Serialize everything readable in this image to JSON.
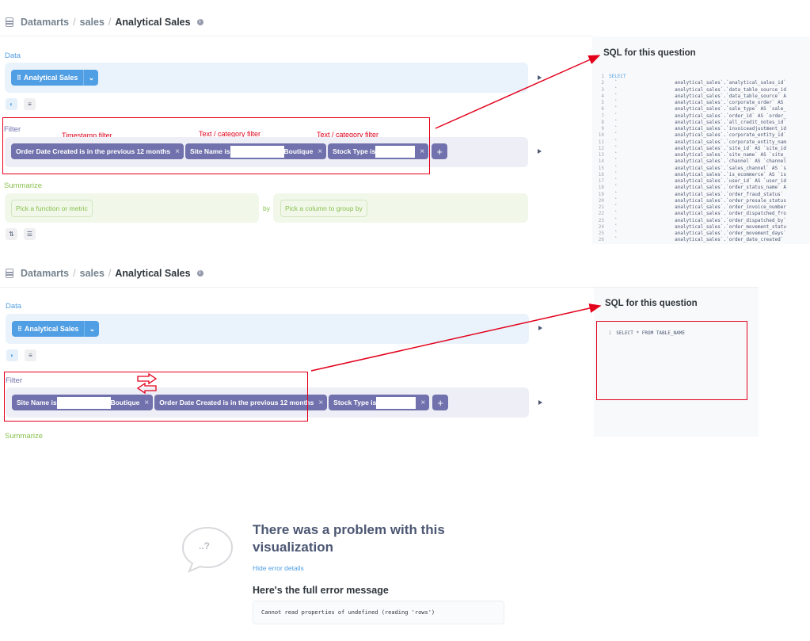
{
  "breadcrumb": {
    "root": "Datamarts",
    "sep": "/",
    "schema": "sales",
    "table": "Analytical Sales"
  },
  "sections": {
    "data": "Data",
    "filter": "Filter",
    "summarize": "Summarize"
  },
  "data_pill": {
    "label": "Analytical Sales",
    "grid_glyph": "⠿",
    "dropdown_glyph": "⌄"
  },
  "filters_top": [
    {
      "label": "Order Date Created is in the previous 12 months"
    },
    {
      "prefix": "Site Name is",
      "suffix": "Boutique"
    },
    {
      "prefix": "Stock Type is",
      "suffix": ""
    }
  ],
  "filters_bottom": [
    {
      "prefix": "Site Name is",
      "suffix": "Boutique"
    },
    {
      "label": "Order Date Created is in the previous 12 months"
    },
    {
      "prefix": "Stock Type is",
      "suffix": ""
    }
  ],
  "close_glyph": "×",
  "add_glyph": "+",
  "annotations": {
    "timestamp": "Timestamp filter",
    "text_category_1": "Text / category filter",
    "text_category_2": "Text / category filter"
  },
  "summarize": {
    "metric": "Pick a function or metric",
    "by": "by",
    "group": "Pick a column to group by"
  },
  "sql": {
    "title": "SQL for this question",
    "top_lines": [
      {
        "n": "1",
        "t": "SELECT",
        "kw": true
      },
      {
        "n": "2",
        "t": "  `                    analytical_sales`.`analytical_sales_id`"
      },
      {
        "n": "3",
        "t": "  `                    analytical_sales`.`data_table_source_id"
      },
      {
        "n": "4",
        "t": "  `                    analytical_sales`.`data_table_source` A"
      },
      {
        "n": "5",
        "t": "  `                    analytical_sales`.`corporate_order` AS"
      },
      {
        "n": "6",
        "t": "  `                    analytical_sales`.`sale_type` AS `sale_"
      },
      {
        "n": "7",
        "t": "  `                    analytical_sales`.`order_id` AS `order_"
      },
      {
        "n": "8",
        "t": "  `                    analytical_sales`.`all_credit_notes_id`"
      },
      {
        "n": "9",
        "t": "  `                    analytical_sales`.`invoiceadjustment_id"
      },
      {
        "n": "10",
        "t": "  `                    analytical_sales`.`corporate_entity_id`"
      },
      {
        "n": "11",
        "t": "  `                    analytical_sales`.`corporate_entity_nam"
      },
      {
        "n": "12",
        "t": "  `                    analytical_sales`.`site_id` AS `site_id"
      },
      {
        "n": "13",
        "t": "  `                    analytical_sales`.`site_name` AS `site_"
      },
      {
        "n": "14",
        "t": "  `                    analytical_sales`.`channel` AS `channel"
      },
      {
        "n": "15",
        "t": "  `                    analytical_sales`.`sales_channel` AS `s"
      },
      {
        "n": "16",
        "t": "  `                    analytical_sales`.`is_ecommerce` AS `is"
      },
      {
        "n": "17",
        "t": "  `                    analytical_sales`.`user_id` AS `user_id"
      },
      {
        "n": "18",
        "t": "  `                    analytical_sales`.`order_status_name` A"
      },
      {
        "n": "19",
        "t": "  `                    analytical_sales`.`order_fraud_status`"
      },
      {
        "n": "20",
        "t": "  `                    analytical_sales`.`order_presale_status"
      },
      {
        "n": "21",
        "t": "  `                    analytical_sales`.`order_invoice_number"
      },
      {
        "n": "22",
        "t": "  `                    analytical_sales`.`order_dispatched_fro"
      },
      {
        "n": "23",
        "t": "  `                    analytical_sales`.`order_dispatched_by`"
      },
      {
        "n": "24",
        "t": "  `                    analytical_sales`.`order_movement_statu"
      },
      {
        "n": "25",
        "t": "  `                    analytical_sales`.`order_movement_days`"
      },
      {
        "n": "26",
        "t": "  `                    analytical_sales`.`order_date_created`"
      }
    ],
    "bottom_line": {
      "n": "1",
      "t": "SELECT * FROM TABLE_NAME"
    }
  },
  "error": {
    "icon_text": "..?",
    "title_line1": "There was a problem with this",
    "title_line2": "visualization",
    "hide_link": "Hide error details",
    "subtitle": "Here's the full error message",
    "message": "Cannot read properties of undefined (reading 'rows')"
  },
  "colors": {
    "accent": "#509ee3",
    "filter": "#7172ad",
    "summarize": "#88bf4d",
    "annotation": "#e3001b"
  }
}
